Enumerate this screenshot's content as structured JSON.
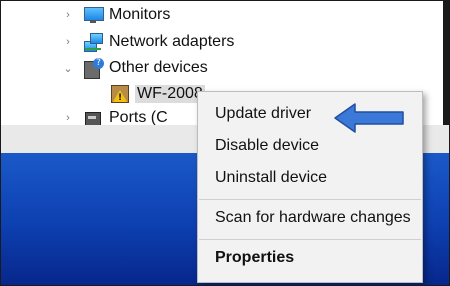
{
  "device_tree": {
    "items": [
      {
        "label": "Monitors",
        "chevron": "›",
        "icon": "monitor-icon"
      },
      {
        "label": "Network adapters",
        "chevron": "›",
        "icon": "network-adapter-icon"
      },
      {
        "label": "Other devices",
        "chevron": "⌄",
        "icon": "unknown-device-icon",
        "expanded": true
      },
      {
        "label": "WF-2008",
        "icon": "device-warning-icon",
        "selected": true
      },
      {
        "label": "Ports (C",
        "chevron": "›",
        "icon": "port-icon"
      }
    ]
  },
  "context_menu": {
    "items": [
      {
        "label": "Update driver",
        "bold": false
      },
      {
        "label": "Disable device",
        "bold": false
      },
      {
        "label": "Uninstall device",
        "bold": false
      },
      {
        "label": "Scan for hardware changes",
        "bold": false
      },
      {
        "label": "Properties",
        "bold": true
      }
    ]
  },
  "annotation": {
    "icon": "left-arrow-icon",
    "points_to": "Update driver",
    "color": "#3b78d8"
  },
  "colors": {
    "desktop_top": "#1a59c9",
    "desktop_bottom": "#07268a",
    "menu_background": "#f2f2f2",
    "selection": "#dcdcdc"
  }
}
